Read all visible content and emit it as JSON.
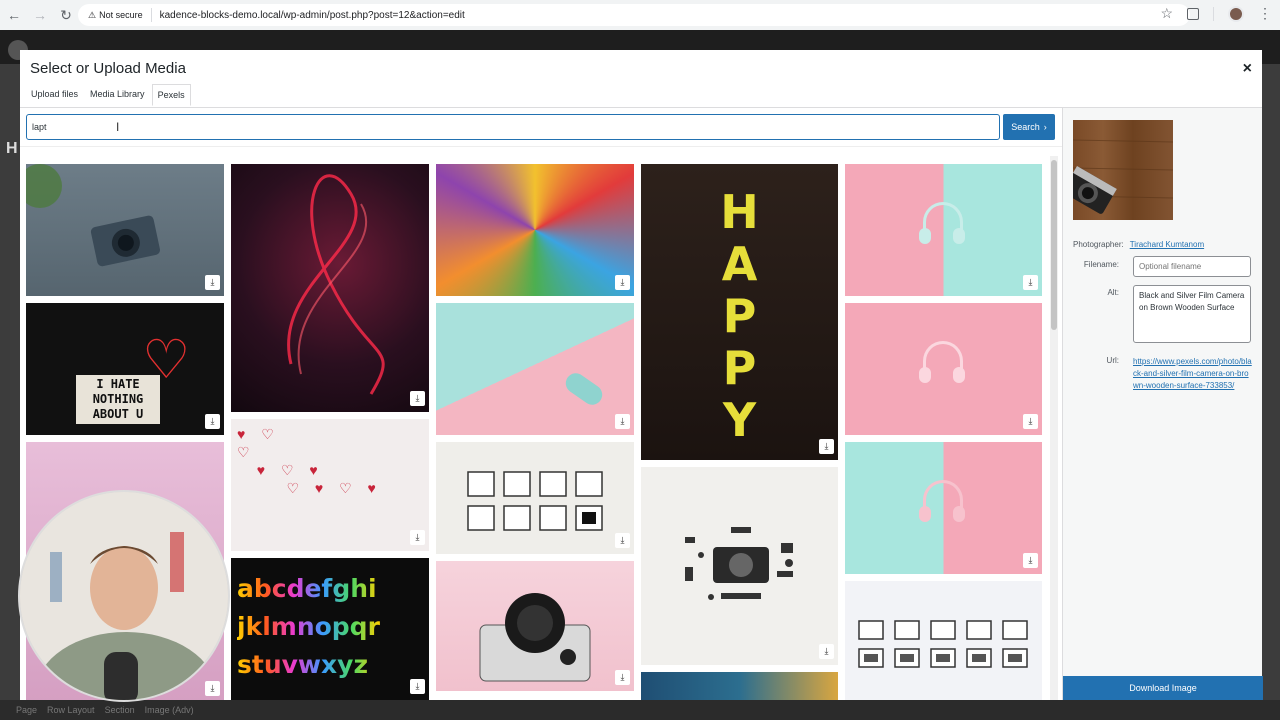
{
  "browser": {
    "security_label": "Not secure",
    "url": "kadence-blocks-demo.local/wp-admin/post.php?post=12&action=edit"
  },
  "background": {
    "heading_letter": "H",
    "breadcrumbs": [
      "Page",
      "Row Layout",
      "Section",
      "Image (Adv)"
    ]
  },
  "modal": {
    "title": "Select or Upload Media",
    "close_icon": "×",
    "tabs": [
      "Upload files",
      "Media Library",
      "Pexels"
    ],
    "active_tab": "Pexels",
    "search": {
      "value": "lapt",
      "button_label": "Search"
    },
    "photos": [
      {
        "label": "camera on blue wood",
        "colors": [
          "#5f6f7c",
          "#7e8e99"
        ]
      },
      {
        "label": "black board I HATE NOTHING ABOUT U",
        "colors": [
          "#121212",
          "#2a2a2a"
        ],
        "text": "I HATE\nNOTHING\nABOUT U"
      },
      {
        "label": "pink wall guitars",
        "colors": [
          "#e7b9d6",
          "#d8a3c6"
        ]
      },
      {
        "label": "red light painting",
        "colors": [
          "#2b1020",
          "#6a1830"
        ]
      },
      {
        "label": "red paper hearts",
        "colors": [
          "#f3eeee",
          "#ece5e5"
        ]
      },
      {
        "label": "colorful alphabet letters",
        "colors": [
          "#0c0c0c",
          "#1a1a1a"
        ],
        "text": "abcdefghi\njklmnopqr\nstuvwxyz"
      },
      {
        "label": "colorful umbrellas",
        "colors": [
          "#f2c12e",
          "#e23b3b"
        ]
      },
      {
        "label": "toy car on mint and pink",
        "colors": [
          "#a9e1dc",
          "#f4b6c2"
        ]
      },
      {
        "label": "picture frames grid",
        "colors": [
          "#f0efeb",
          "#e8e7e2"
        ]
      },
      {
        "label": "vintage camera on pink",
        "colors": [
          "#f5cfd9",
          "#f2c2cf"
        ]
      },
      {
        "label": "HAPPY neon letters",
        "colors": [
          "#1f1714",
          "#3a2a22"
        ],
        "text": "HAPPY"
      },
      {
        "label": "camera knolling flat lay",
        "colors": [
          "#f2f1ee",
          "#e9e8e4"
        ]
      },
      {
        "label": "blue abstract painting",
        "colors": [
          "#1f4e73",
          "#2c6e8f"
        ]
      },
      {
        "label": "headphones pink and mint",
        "colors": [
          "#f4a8b8",
          "#a8e6de"
        ]
      },
      {
        "label": "headphones on pink",
        "colors": [
          "#f4a8b8",
          "#f0b4c1"
        ]
      },
      {
        "label": "headphones pink and mint 2",
        "colors": [
          "#f4a8b8",
          "#a8e6de"
        ]
      },
      {
        "label": "picture frames on wall",
        "colors": [
          "#f2f3f7",
          "#eceef3"
        ]
      }
    ],
    "details": {
      "photographer_label": "Photographer:",
      "photographer": "Tirachard Kumtanom",
      "filename_label": "Filename:",
      "filename_placeholder": "Optional filename",
      "alt_label": "Alt:",
      "alt_value": "Black and Silver Film Camera on Brown Wooden Surface",
      "url_label": "Url:",
      "url_value": "https://www.pexels.com/photo/black-and-silver-film-camera-on-brown-wooden-surface-733853/",
      "download_label": "Download Image"
    }
  }
}
